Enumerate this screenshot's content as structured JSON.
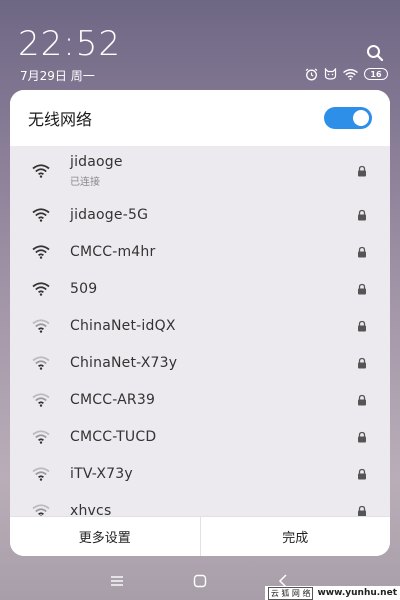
{
  "status_bar": {
    "time": "22:52",
    "date": "7月29日 周一",
    "battery": "16",
    "icons": [
      "alarm-icon",
      "cat-face-icon",
      "wifi-icon",
      "battery-icon"
    ]
  },
  "wifi_panel": {
    "title": "无线网络",
    "toggle_on": true,
    "networks": [
      {
        "name": "jidaoge",
        "status": "已连接",
        "signal": "strong",
        "locked": true
      },
      {
        "name": "jidaoge-5G",
        "status": "",
        "signal": "strong",
        "locked": true
      },
      {
        "name": "CMCC-m4hr",
        "status": "",
        "signal": "strong",
        "locked": true
      },
      {
        "name": "509",
        "status": "",
        "signal": "strong",
        "locked": true
      },
      {
        "name": "ChinaNet-idQX",
        "status": "",
        "signal": "weak",
        "locked": true
      },
      {
        "name": "ChinaNet-X73y",
        "status": "",
        "signal": "weak",
        "locked": true
      },
      {
        "name": "CMCC-AR39",
        "status": "",
        "signal": "weak",
        "locked": true
      },
      {
        "name": "CMCC-TUCD",
        "status": "",
        "signal": "weak",
        "locked": true
      },
      {
        "name": "iTV-X73y",
        "status": "",
        "signal": "weak",
        "locked": true
      },
      {
        "name": "xhvcs",
        "status": "",
        "signal": "weak",
        "locked": true
      }
    ],
    "footer": {
      "more_settings": "更多设置",
      "done": "完成"
    }
  },
  "watermark": {
    "text_cn": "云 狐 网 络",
    "url": "www.yunhu.net"
  },
  "colors": {
    "accent": "#2e8fe8",
    "panel_bg": "#ffffff",
    "list_bg": "#eceaef"
  }
}
